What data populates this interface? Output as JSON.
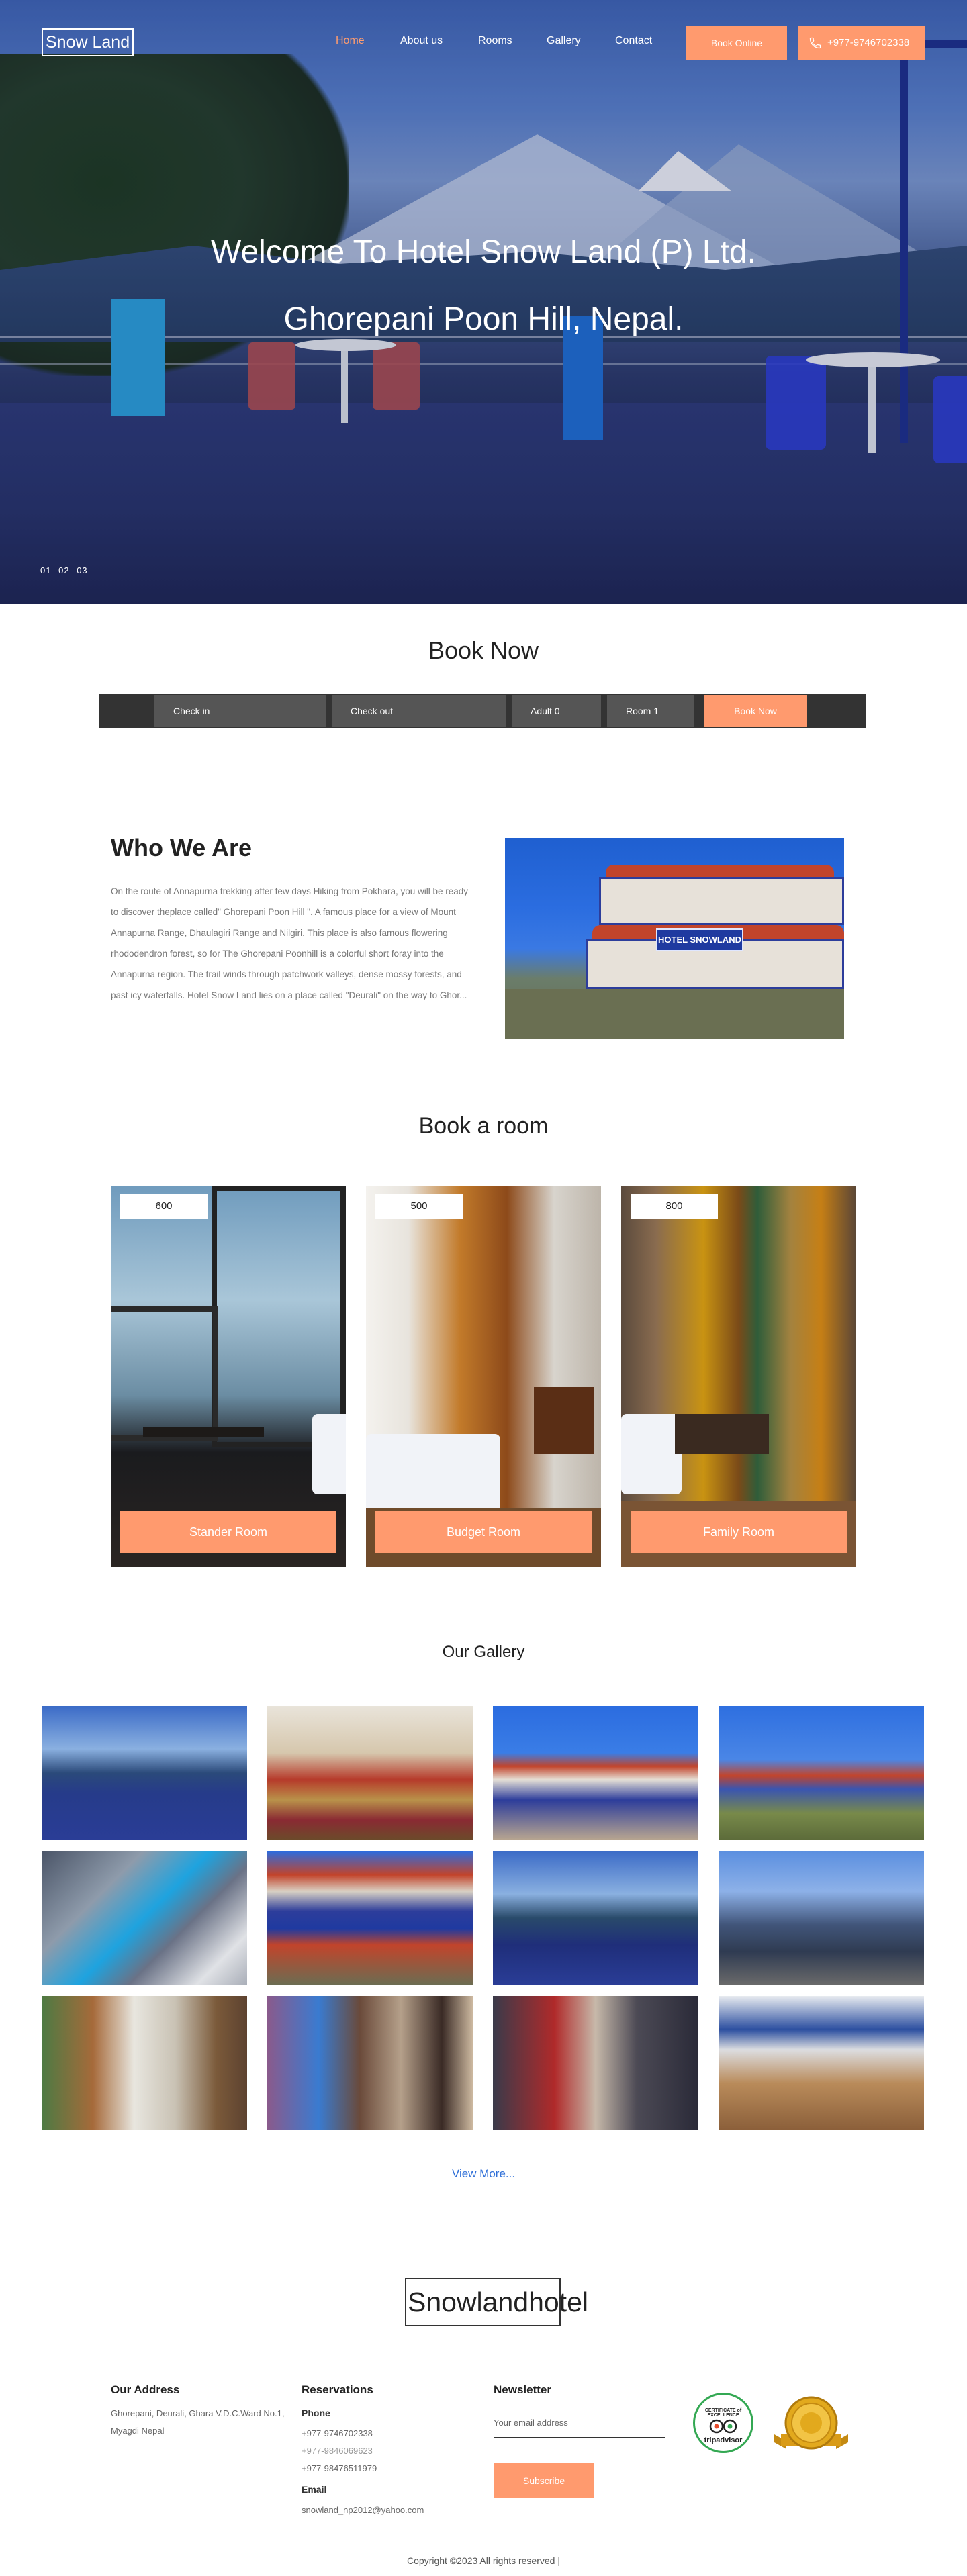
{
  "brand": {
    "logo": "Snow Land",
    "footer_logo": "Snowlandhotel"
  },
  "nav": {
    "items": [
      "Home",
      "About us",
      "Rooms",
      "Gallery",
      "Contact"
    ],
    "active": "Home",
    "book_online": "Book Online",
    "phone": "+977-9746702338"
  },
  "hero": {
    "line1": "Welcome To Hotel Snow Land (P) Ltd.",
    "line2": "Ghorepani Poon Hill, Nepal.",
    "slides": [
      "01",
      "02",
      "03"
    ]
  },
  "booking": {
    "title": "Book Now",
    "check_in": "Check in",
    "check_out": "Check out",
    "adult": "Adult 0",
    "room": "Room 1",
    "button": "Book Now"
  },
  "about": {
    "title": "Who We Are",
    "text": "On the route of Annapurna trekking after few days Hiking from Pokhara, you will be ready to discover theplace called\" Ghorepani Poon Hill \". A famous place for a view of Mount Annapurna Range, Dhaulagiri Range and Nilgiri. This place is also famous flowering rhododendron forest, so for The Ghorepani Poonhill is a colorful short foray into the Annapurna region. The trail winds through patchwork valleys, dense mossy forests, and past icy waterfalls. Hotel Snow Land lies on a place called \"Deurali\" on the way to Ghor...",
    "sign": "HOTEL SNOWLAND"
  },
  "rooms": {
    "title": "Book a room",
    "items": [
      {
        "price": "600",
        "name": "Stander Room"
      },
      {
        "price": "500",
        "name": "Budget Room"
      },
      {
        "price": "800",
        "name": "Family Room"
      }
    ]
  },
  "gallery": {
    "title": "Our Gallery",
    "view_more": "View More..."
  },
  "footer": {
    "address_title": "Our Address",
    "address": "Ghorepani, Deurali, Ghara V.D.C.Ward No.1, Myagdi Nepal",
    "reservations_title": "Reservations",
    "phone_label": "Phone",
    "phones": [
      "+977-9746702338",
      "+977-9846069623",
      "+977-98476511979"
    ],
    "email_label": "Email",
    "email": "snowland_np2012@yahoo.com",
    "newsletter_title": "Newsletter",
    "email_placeholder": "Your email address",
    "subscribe": "Subscribe",
    "tripadvisor_award": "CERTIFICATE of EXCELLENCE",
    "tripadvisor_name": "tripadvisor",
    "copyright": "Copyright ©2023 All rights reserved |"
  },
  "colors": {
    "accent": "#ff9a6e",
    "link": "#2f6fd8",
    "dark": "#333333"
  }
}
